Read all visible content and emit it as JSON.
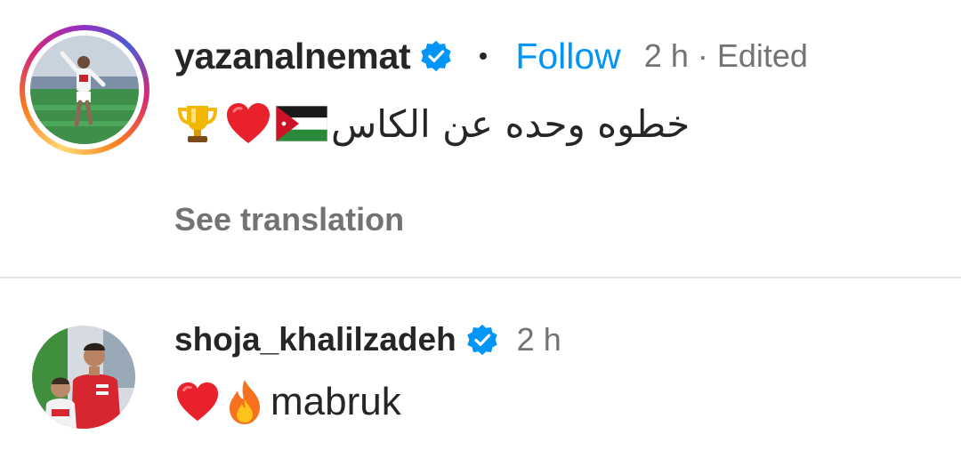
{
  "post": {
    "username": "yazanalnemat",
    "follow_label": "Follow",
    "time": "2 h",
    "edited": "· Edited",
    "caption_text": "خطوه وحده عن الكاس",
    "caption_emojis": [
      "trophy-icon",
      "red-heart-icon",
      "jordan-flag-icon"
    ],
    "see_translation": "See translation"
  },
  "comment": {
    "username": "shoja_khalilzadeh",
    "time": "2 h",
    "text": "mabruk",
    "emojis": [
      "red-heart-icon",
      "fire-icon"
    ]
  },
  "colors": {
    "follow": "#0095f6",
    "verified": "#0095f6",
    "muted": "#737373",
    "text": "#262626"
  }
}
